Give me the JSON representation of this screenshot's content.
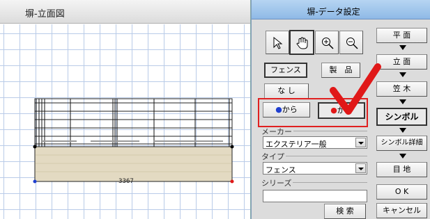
{
  "left": {
    "title": "塀-立面図",
    "dimension": "3367"
  },
  "dialog": {
    "title": "塀-データ設定",
    "tools": [
      "arrow-cursor-icon",
      "hand-pan-icon",
      "zoom-in-icon",
      "zoom-out-icon"
    ],
    "type_buttons": {
      "fence": "フェンス",
      "product": "製　品"
    },
    "none_button": "な し",
    "from_blue": "から",
    "from_red": "から",
    "maker": {
      "label": "メーカー",
      "value": "エクステリア一般"
    },
    "type": {
      "label": "タイプ",
      "value": "フェンス"
    },
    "series": {
      "label": "シリーズ",
      "value": ""
    },
    "search_button": "検 索",
    "nav": {
      "plan": "平 面",
      "elevation": "立 面",
      "kasagi": "笠 木",
      "symbol": "シンボル",
      "symbol_detail": "シンボル詳細",
      "joint": "目 地",
      "ok": "O K",
      "cancel": "キャンセル"
    },
    "colors": {
      "blue_dot": "#1f3fd0",
      "red_dot": "#e01818",
      "highlight": "#e02020"
    }
  }
}
